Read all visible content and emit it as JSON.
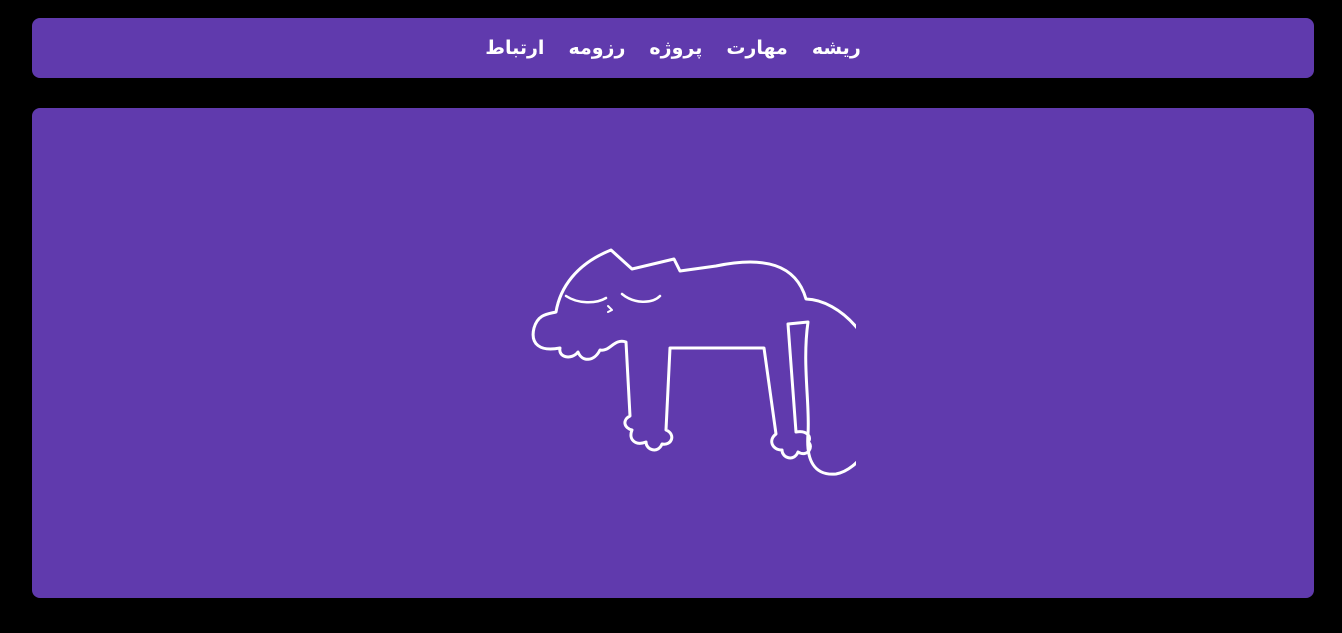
{
  "colors": {
    "background": "#000000",
    "panel": "#603aad",
    "nav_text": "#ffffff",
    "nav_highlight": "#fff59d",
    "illustration_stroke": "#ffffff"
  },
  "nav": {
    "items": [
      {
        "label": "ارتباط",
        "icon": ""
      },
      {
        "label": "رزومه",
        "icon": ""
      },
      {
        "label": "پروژه",
        "icon": ""
      },
      {
        "label": "مهارت",
        "icon": ""
      },
      {
        "label": "ریشه",
        "icon": ""
      }
    ]
  },
  "hero": {
    "illustration": "sleeping-cat-icon"
  }
}
